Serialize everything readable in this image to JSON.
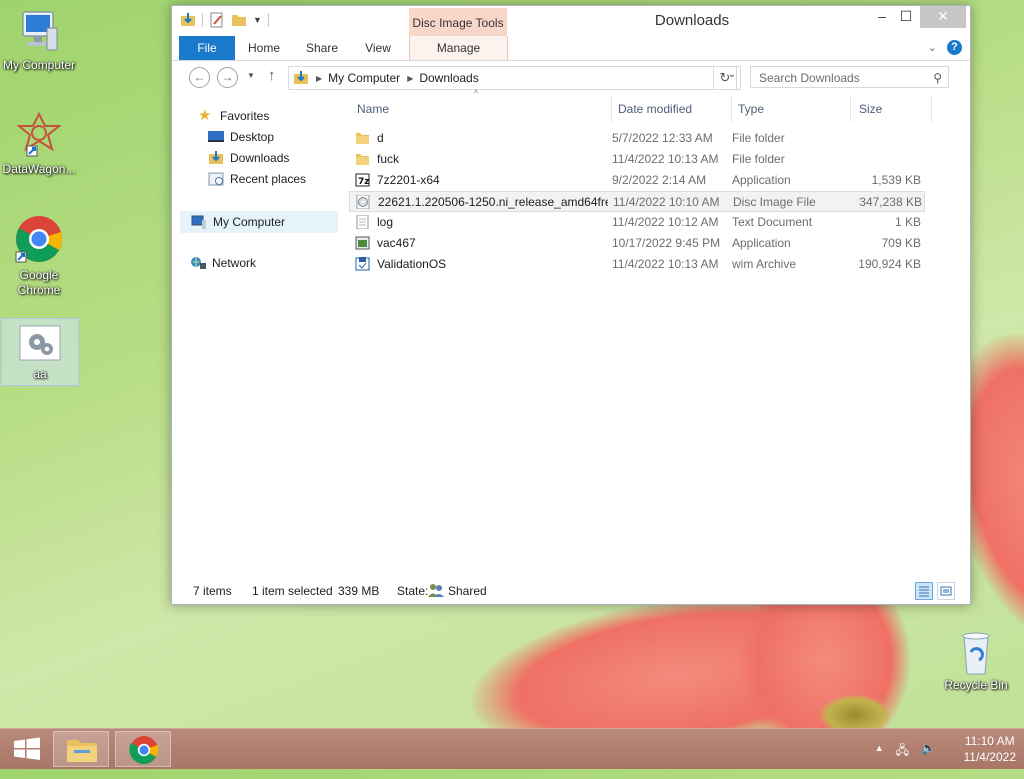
{
  "desktop": {
    "icons": [
      {
        "label": "My Computer"
      },
      {
        "label": "DataWagon..."
      },
      {
        "label": "Google Chrome"
      },
      {
        "label": "aa"
      },
      {
        "label": "Recycle Bin"
      }
    ]
  },
  "window": {
    "title": "Downloads",
    "context_tab_group": "Disc Image Tools",
    "ribbon_tabs": [
      "File",
      "Home",
      "Share",
      "View",
      "Manage"
    ],
    "address": {
      "crumbs": [
        "My Computer",
        "Downloads"
      ]
    },
    "search_placeholder": "Search Downloads",
    "nav": {
      "favorites_label": "Favorites",
      "favorites": [
        "Desktop",
        "Downloads",
        "Recent places"
      ],
      "my_computer": "My Computer",
      "network": "Network"
    },
    "columns": [
      "Name",
      "Date modified",
      "Type",
      "Size"
    ],
    "files": [
      {
        "name": "d",
        "date": "5/7/2022 12:33 AM",
        "type": "File folder",
        "size": "",
        "icon": "folder-icon"
      },
      {
        "name": "fuck",
        "date": "11/4/2022 10:13 AM",
        "type": "File folder",
        "size": "",
        "icon": "folder-icon"
      },
      {
        "name": "7z2201-x64",
        "date": "9/2/2022 2:14 AM",
        "type": "Application",
        "size": "1,539 KB",
        "icon": "7zip-app-icon"
      },
      {
        "name": "22621.1.220506-1250.ni_release_amd64fre...",
        "date": "11/4/2022 10:10 AM",
        "type": "Disc Image File",
        "size": "347,238 KB",
        "icon": "disc-image-icon"
      },
      {
        "name": "log",
        "date": "11/4/2022 10:12 AM",
        "type": "Text Document",
        "size": "1 KB",
        "icon": "text-document-icon"
      },
      {
        "name": "vac467",
        "date": "10/17/2022 9:45 PM",
        "type": "Application",
        "size": "709 KB",
        "icon": "application-icon"
      },
      {
        "name": "ValidationOS",
        "date": "11/4/2022 10:13 AM",
        "type": "wim Archive",
        "size": "190,924 KB",
        "icon": "wim-archive-icon"
      }
    ],
    "status": {
      "items": "7 items",
      "selected": "1 item selected",
      "selected_size": "339 MB",
      "state_label": "State:",
      "state_value": "Shared"
    }
  },
  "taskbar": {
    "time": "11:10 AM",
    "date": "11/4/2022"
  },
  "colors": {
    "file_tab": "#1979ca",
    "context_tab": "#f8d7c9",
    "taskbar": "#a97666",
    "folder": "#e8c15a"
  }
}
